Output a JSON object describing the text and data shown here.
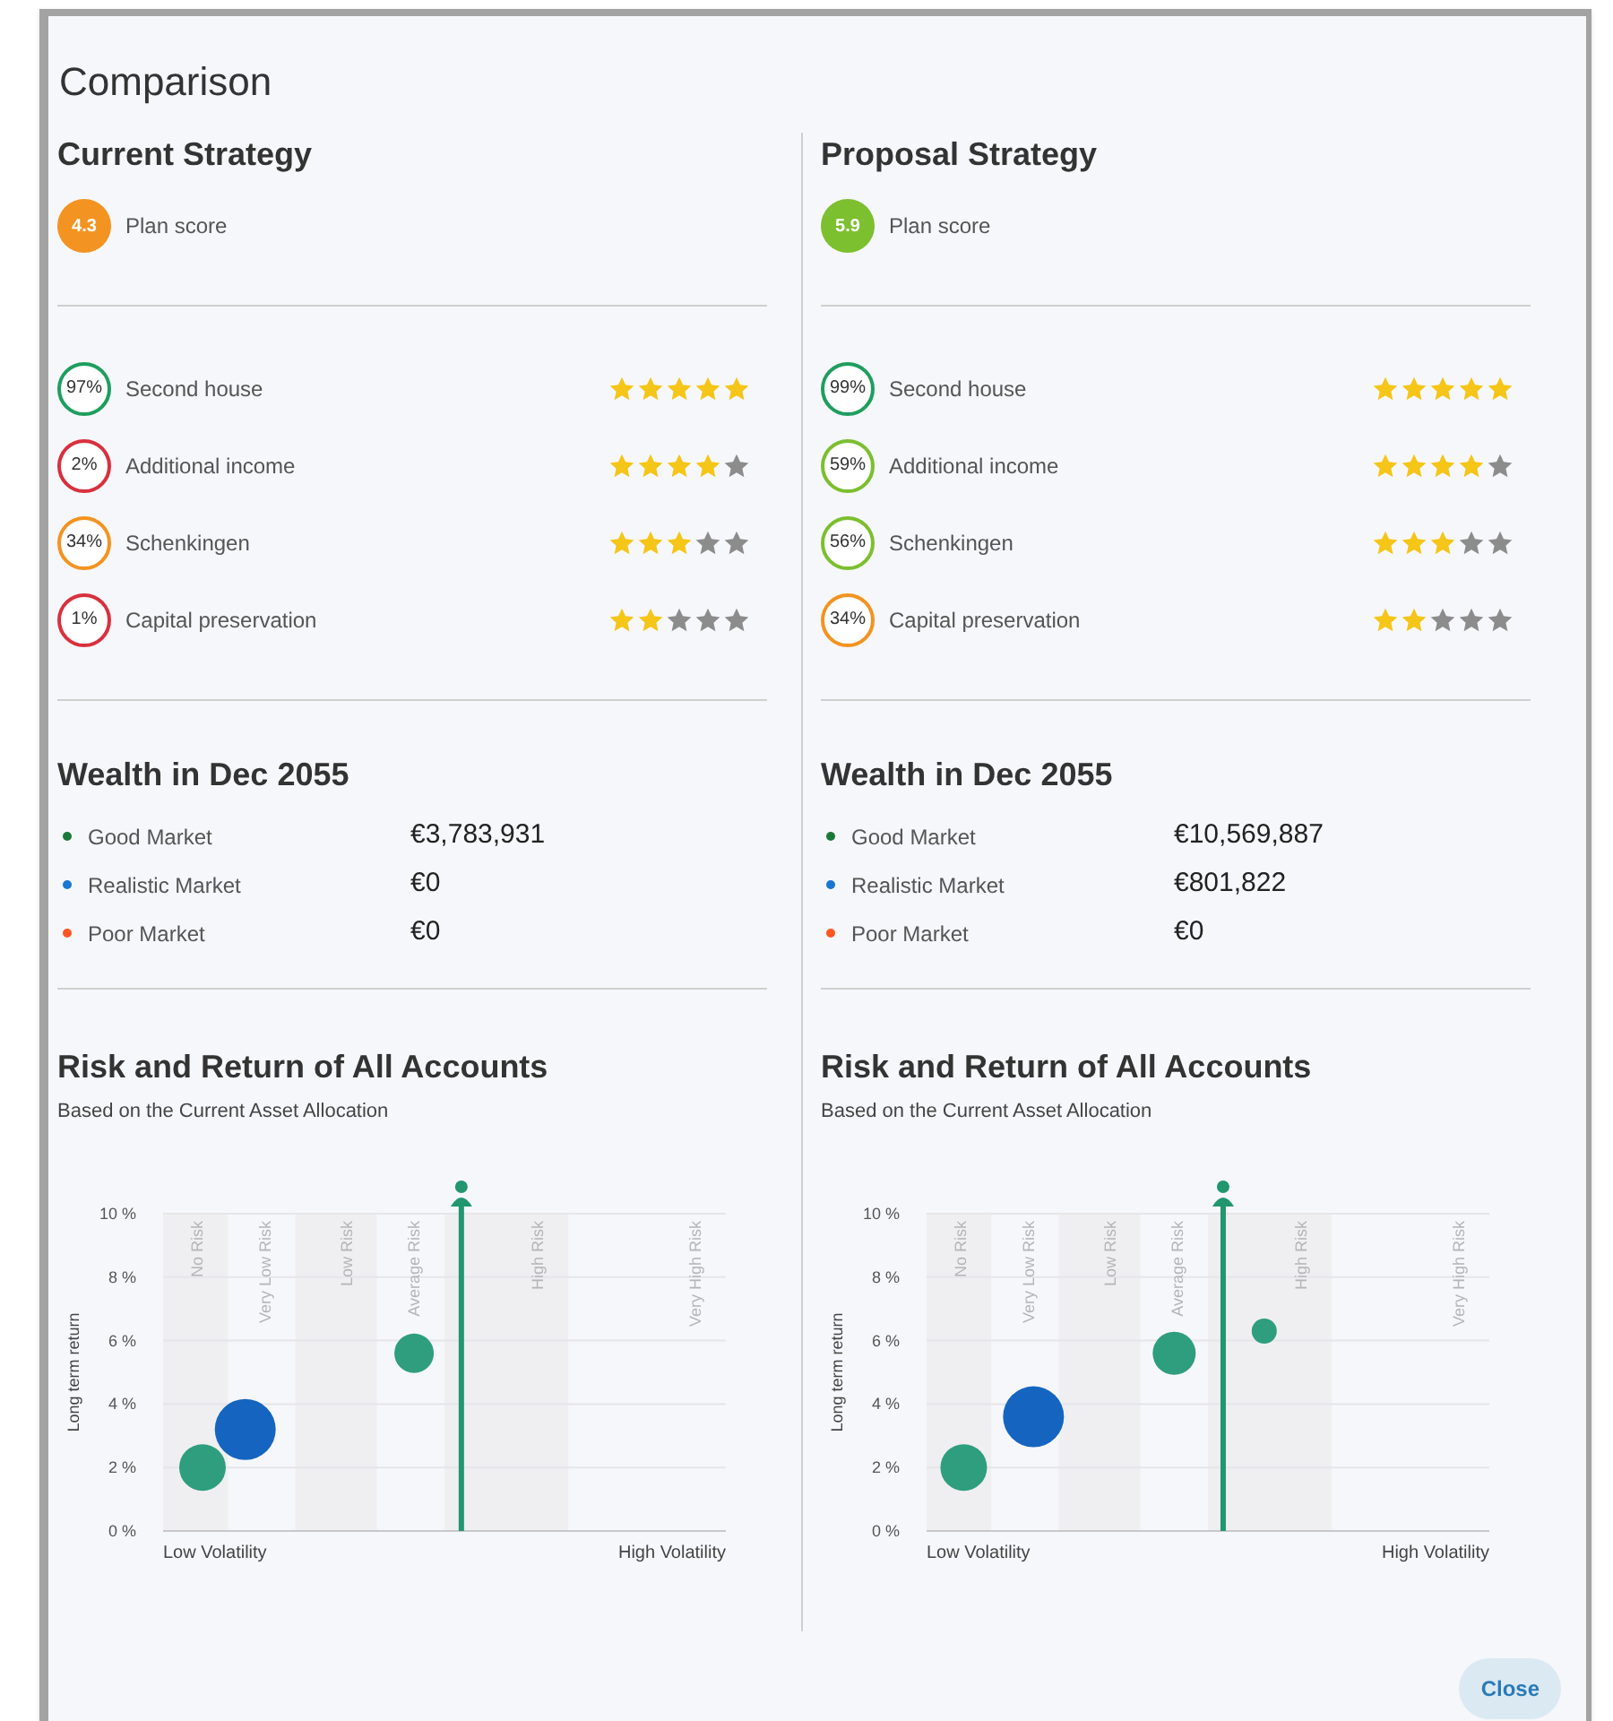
{
  "dialog": {
    "title": "Comparison",
    "close_button": "Close"
  },
  "strategies": [
    {
      "title": "Current Strategy",
      "plan_score": {
        "value": "4.3",
        "label": "Plan score",
        "color": "#f39321"
      },
      "goals": [
        {
          "percent": "97%",
          "name": "Second house",
          "color": "#1e9e5e",
          "stars": 5
        },
        {
          "percent": "2%",
          "name": "Additional income",
          "color": "#d9303e",
          "stars": 4
        },
        {
          "percent": "34%",
          "name": "Schenkingen",
          "color": "#f39321",
          "stars": 3
        },
        {
          "percent": "1%",
          "name": "Capital preservation",
          "color": "#d9303e",
          "stars": 2
        }
      ],
      "wealth": {
        "title": "Wealth in Dec 2055",
        "rows": [
          {
            "label": "Good Market",
            "value": "€3,783,931",
            "color": "#1b7a3a"
          },
          {
            "label": "Realistic Market",
            "value": "€0",
            "color": "#1976d2"
          },
          {
            "label": "Poor Market",
            "value": "€0",
            "color": "#ff5722"
          }
        ]
      },
      "risk": {
        "title": "Risk and Return of All Accounts",
        "subtitle": "Based on the Current Asset Allocation",
        "chart": {
          "y_axis_title": "Long term return",
          "y_tick_labels": [
            "10 %",
            "8 %",
            "6 %",
            "4 %",
            "2 %",
            "0 %"
          ],
          "band_labels": [
            "No Risk",
            "Very Low Risk",
            "Low Risk",
            "Average Risk",
            "High Risk",
            "Very High Risk"
          ],
          "x_axis_ends": [
            "Low Volatility",
            "High Volatility"
          ]
        }
      }
    },
    {
      "title": "Proposal Strategy",
      "plan_score": {
        "value": "5.9",
        "label": "Plan score",
        "color": "#7cbf2f"
      },
      "goals": [
        {
          "percent": "99%",
          "name": "Second house",
          "color": "#1e9e5e",
          "stars": 5
        },
        {
          "percent": "59%",
          "name": "Additional income",
          "color": "#7cbf2f",
          "stars": 4
        },
        {
          "percent": "56%",
          "name": "Schenkingen",
          "color": "#7cbf2f",
          "stars": 3
        },
        {
          "percent": "34%",
          "name": "Capital preservation",
          "color": "#f39321",
          "stars": 2
        }
      ],
      "wealth": {
        "title": "Wealth in Dec 2055",
        "rows": [
          {
            "label": "Good Market",
            "value": "€10,569,887",
            "color": "#1b7a3a"
          },
          {
            "label": "Realistic Market",
            "value": "€801,822",
            "color": "#1976d2"
          },
          {
            "label": "Poor Market",
            "value": "€0",
            "color": "#ff5722"
          }
        ]
      },
      "risk": {
        "title": "Risk and Return of All Accounts",
        "subtitle": "Based on the Current Asset Allocation",
        "chart": {
          "y_axis_title": "Long term return",
          "y_tick_labels": [
            "10 %",
            "8 %",
            "6 %",
            "4 %",
            "2 %",
            "0 %"
          ],
          "band_labels": [
            "No Risk",
            "Very Low Risk",
            "Low Risk",
            "Average Risk",
            "High Risk",
            "Very High Risk"
          ],
          "x_axis_ends": [
            "Low Volatility",
            "High Volatility"
          ]
        }
      }
    }
  ]
}
